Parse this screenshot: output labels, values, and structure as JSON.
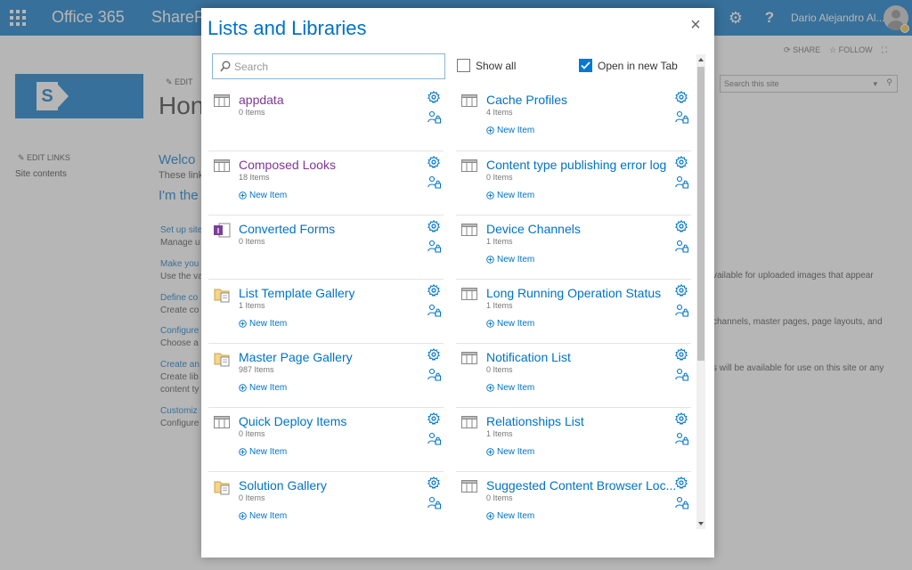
{
  "suitebar": {
    "brand": "Office 365",
    "app": "ShareP",
    "user": "Dario Alejandro Al...",
    "help": "?"
  },
  "background": {
    "share": "SHARE",
    "follow": "FOLLOW",
    "edit_top": "EDIT",
    "title": "Hon",
    "search_placeholder": "Search this site",
    "edit_links": "EDIT LINKS",
    "site_contents": "Site contents",
    "welcome": "Welco",
    "these": "These link",
    "im": "I'm the",
    "items": [
      {
        "link": "Set up site",
        "desc": "Manage u"
      },
      {
        "link": "Make you",
        "desc": "Use the va"
      },
      {
        "link": "Define co",
        "desc": "Create co"
      },
      {
        "link": "Configure",
        "desc": "Choose a"
      },
      {
        "link": "Create an",
        "desc": "Create lib",
        "desc2": "content ty"
      },
      {
        "link": "Customiz",
        "desc": "Configure"
      }
    ],
    "right_texts": [
      ".",
      "vailable for uploaded images that appear",
      "channels, master pages, page layouts, and",
      "s will be available for use on this site or any"
    ]
  },
  "dialog": {
    "title": "Lists and Libraries",
    "search_placeholder": "Search",
    "show_all": {
      "label": "Show all",
      "checked": false
    },
    "open_new_tab": {
      "label": "Open in new Tab",
      "checked": true
    },
    "new_item_label": "New Item",
    "lists": [
      {
        "name": "appdata",
        "count": "0 Items",
        "icon": "list-icon",
        "color": "purple",
        "new_item": false
      },
      {
        "name": "Cache Profiles",
        "count": "4 Items",
        "icon": "list-icon",
        "color": "blue",
        "new_item": true
      },
      {
        "name": "Composed Looks",
        "count": "18 Items",
        "icon": "list-icon",
        "color": "purple",
        "new_item": true
      },
      {
        "name": "Content type publishing error log",
        "count": "0 Items",
        "icon": "list-icon",
        "color": "blue",
        "new_item": true
      },
      {
        "name": "Converted Forms",
        "count": "0 Items",
        "icon": "infopath-icon",
        "color": "blue",
        "new_item": false
      },
      {
        "name": "Device Channels",
        "count": "1 Items",
        "icon": "list-icon",
        "color": "blue",
        "new_item": true
      },
      {
        "name": "List Template Gallery",
        "count": "1 Items",
        "icon": "library-icon",
        "color": "blue",
        "new_item": true
      },
      {
        "name": "Long Running Operation Status",
        "count": "1 Items",
        "icon": "list-icon",
        "color": "blue",
        "new_item": true
      },
      {
        "name": "Master Page Gallery",
        "count": "987 Items",
        "icon": "library-icon",
        "color": "blue",
        "new_item": true
      },
      {
        "name": "Notification List",
        "count": "0 Items",
        "icon": "list-icon",
        "color": "blue",
        "new_item": true
      },
      {
        "name": "Quick Deploy Items",
        "count": "0 Items",
        "icon": "list-icon",
        "color": "blue",
        "new_item": true
      },
      {
        "name": "Relationships List",
        "count": "1 Items",
        "icon": "list-icon",
        "color": "blue",
        "new_item": true
      },
      {
        "name": "Solution Gallery",
        "count": "0 Items",
        "icon": "library-icon",
        "color": "blue",
        "new_item": true
      },
      {
        "name": "Suggested Content Browser Loc...",
        "count": "0 Items",
        "icon": "list-icon",
        "color": "blue",
        "new_item": true
      }
    ]
  }
}
